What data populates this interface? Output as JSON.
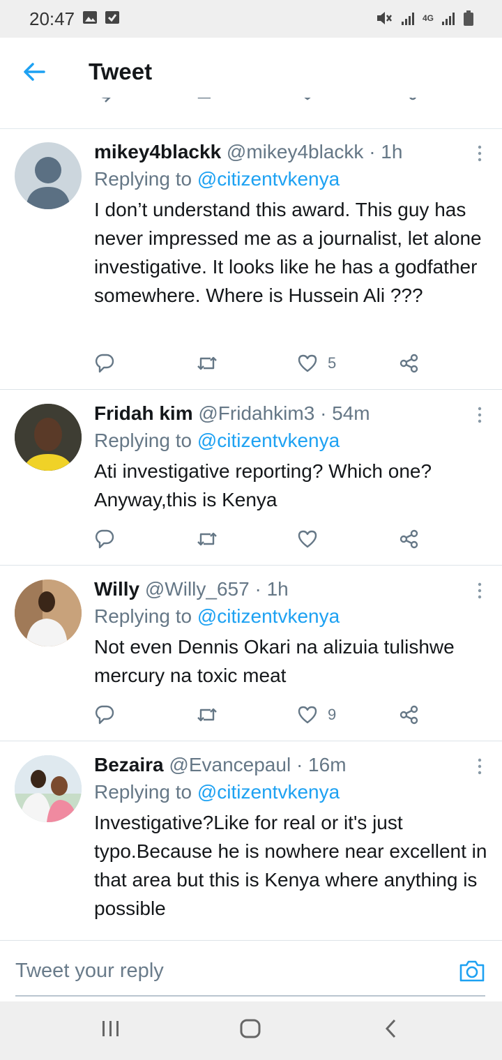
{
  "status_bar": {
    "time": "20:47",
    "network": "4G"
  },
  "header": {
    "title": "Tweet"
  },
  "tweets": [
    {
      "name": "mikey4blackk",
      "handle": "@mikey4blackk",
      "time": "· 1h",
      "reply_prefix": "Replying to",
      "reply_handle": "@citizentvkenya",
      "text": "I don’t understand this award. This guy has never impressed me as a journalist, let alone investigative. It looks like he has a godfather somewhere. Where is Hussein Ali ???",
      "likes": "5"
    },
    {
      "name": "Fridah kim",
      "handle": "@Fridahkim3",
      "time": "· 54m",
      "reply_prefix": "Replying to",
      "reply_handle": "@citizentvkenya",
      "text": "Ati investigative reporting? Which one? Anyway,this is Kenya",
      "likes": ""
    },
    {
      "name": "Willy",
      "handle": "@Willy_657",
      "time": "· 1h",
      "reply_prefix": "Replying to",
      "reply_handle": "@citizentvkenya",
      "text": "Not even Dennis Okari na alizuia tulishwe mercury na toxic meat",
      "likes": "9"
    },
    {
      "name": "Bezaira",
      "handle": "@Evancepaul",
      "time": "· 16m",
      "reply_prefix": "Replying to",
      "reply_handle": "@citizentvkenya",
      "text": "Investigative?Like for real or it's just typo.Because he is nowhere near excellent in that area but this is Kenya where anything is possible",
      "likes": ""
    }
  ],
  "composer": {
    "placeholder": "Tweet your reply"
  },
  "colors": {
    "accent": "#1da1f2",
    "text": "#14171a",
    "muted": "#657786"
  },
  "icons": [
    "back-arrow-icon",
    "reply-icon",
    "retweet-icon",
    "like-icon",
    "share-icon",
    "more-icon",
    "camera-icon",
    "recents-icon",
    "home-icon",
    "back-icon"
  ]
}
